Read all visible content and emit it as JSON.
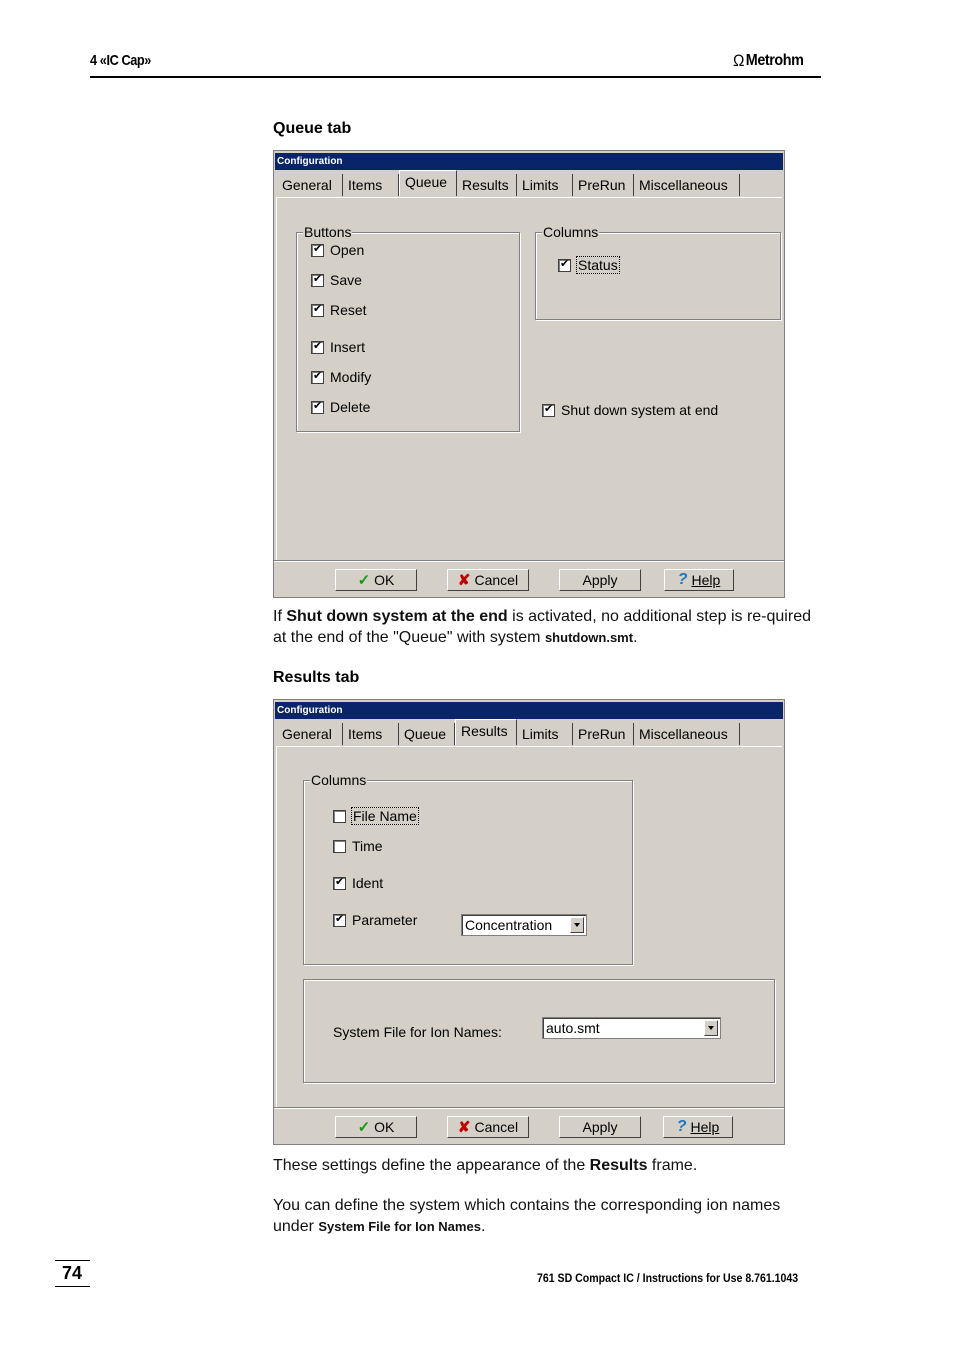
{
  "header": {
    "chapter": "4  «IC Cap»",
    "brand": "Metrohm",
    "brand_icon": "omega-logo-icon"
  },
  "queue_section": {
    "title": "Queue tab",
    "dialog": {
      "title": "Configuration",
      "tabs": [
        "General",
        "Items",
        "Queue",
        "Results",
        "Limits",
        "PreRun",
        "Miscellaneous"
      ],
      "active_tab": "Queue",
      "buttons_group": {
        "label": "Buttons",
        "items": [
          {
            "label": "Open",
            "checked": true
          },
          {
            "label": "Save",
            "checked": true
          },
          {
            "label": "Reset",
            "checked": true
          },
          {
            "label": "Insert",
            "checked": true
          },
          {
            "label": "Modify",
            "checked": true
          },
          {
            "label": "Delete",
            "checked": true
          }
        ]
      },
      "columns_group": {
        "label": "Columns",
        "items": [
          {
            "label": "Status",
            "checked": true
          }
        ]
      },
      "shutdown": {
        "label": "Shut down system at end",
        "checked": true
      },
      "footer_buttons": {
        "ok": "OK",
        "cancel": "Cancel",
        "apply": "Apply",
        "help": "Help"
      }
    },
    "description": {
      "prefix": "If ",
      "bold": "Shut down system at the end",
      "middle": " is activated, no additional step is re-quired at the end of the \"Queue\" with system ",
      "file": "shutdown.smt",
      "suffix": "."
    }
  },
  "results_section": {
    "title": "Results tab",
    "dialog": {
      "title": "Configuration",
      "tabs": [
        "General",
        "Items",
        "Queue",
        "Results",
        "Limits",
        "PreRun",
        "Miscellaneous"
      ],
      "active_tab": "Results",
      "columns_group": {
        "label": "Columns",
        "items": [
          {
            "label": "File Name",
            "checked": false
          },
          {
            "label": "Time",
            "checked": false
          },
          {
            "label": "Ident",
            "checked": true
          },
          {
            "label": "Parameter",
            "checked": true
          }
        ]
      },
      "parameter_select": {
        "value": "Concentration"
      },
      "ion_names": {
        "label": "System File for Ion Names:",
        "value": "auto.smt"
      },
      "footer_buttons": {
        "ok": "OK",
        "cancel": "Cancel",
        "apply": "Apply",
        "help": "Help"
      }
    },
    "description1": {
      "prefix": "These settings define the appearance of the ",
      "bold": "Results",
      "suffix": " frame."
    },
    "description2": {
      "prefix": "You can define the system which contains the corresponding ion names under ",
      "bold": "System File for Ion Names",
      "suffix": "."
    }
  },
  "footer": {
    "page_number": "74",
    "doc_title": "761 SD Compact IC / Instructions for Use  8.761.1043"
  },
  "glyphs": {
    "check": "✔",
    "tick": "✓",
    "cross": "✘",
    "question": "?",
    "omega": "Ω"
  }
}
